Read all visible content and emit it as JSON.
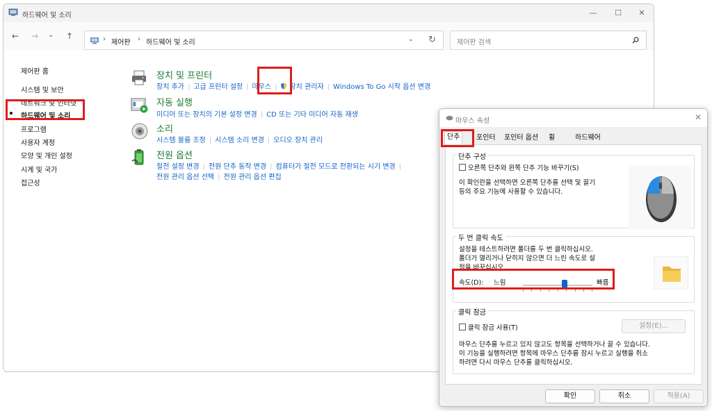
{
  "window": {
    "title": "하드웨어 및 소리",
    "controls": {
      "minimize": "—",
      "maximize": "☐",
      "close": "✕"
    }
  },
  "nav": {
    "back": "←",
    "forward": "→",
    "recent": "⌄",
    "up": "↑",
    "breadcrumb": [
      "제어판",
      "하드웨어 및 소리"
    ],
    "separator": "›",
    "dropdown": "⌄",
    "refresh": "↻",
    "search_placeholder": "제어판 검색"
  },
  "sidebar": {
    "home": "제어판 홈",
    "items": [
      {
        "label": "시스템 및 보안",
        "active": false
      },
      {
        "label": "네트워크 및 인터넷",
        "active": false
      },
      {
        "label": "하드웨어 및 소리",
        "active": true
      },
      {
        "label": "프로그램",
        "active": false
      },
      {
        "label": "사용자 계정",
        "active": false
      },
      {
        "label": "모양 및 개인 설정",
        "active": false
      },
      {
        "label": "시계 및 국가",
        "active": false
      },
      {
        "label": "접근성",
        "active": false
      }
    ]
  },
  "categories": [
    {
      "title": "장치 및 프린터",
      "icon": "printer-icon",
      "links": [
        "장치 추가",
        "고급 프린터 설정",
        "마우스",
        "장치 관리자",
        "Windows To Go 시작 옵션 변경"
      ]
    },
    {
      "title": "자동 실행",
      "icon": "autoplay-icon",
      "links": [
        "미디어 또는 장치의 기본 설정 변경",
        "CD 또는 기타 미디어 자동 재생"
      ]
    },
    {
      "title": "소리",
      "icon": "speaker-icon",
      "links": [
        "시스템 볼륨 조정",
        "시스템 소리 변경",
        "오디오 장치 관리"
      ]
    },
    {
      "title": "전원 옵션",
      "icon": "battery-icon",
      "links": [
        "절전 설정 변경",
        "전원 단추 동작 변경",
        "컴퓨터가 절전 모드로 전환되는 시기 변경"
      ],
      "links2": [
        "전원 관리 옵션 선택",
        "전원 관리 옵션 편집"
      ]
    }
  ],
  "dialog": {
    "title": "마우스 속성",
    "close": "✕",
    "tabs": [
      "단추",
      "포인터",
      "포인터 옵션",
      "휠",
      "하드웨어"
    ],
    "active_tab": "단추",
    "button_config": {
      "group_title": "단추 구성",
      "checkbox_label": "오른쪽 단추와 왼쪽 단추 기능 바꾸기(S)",
      "checked": false,
      "description": [
        "이 확인란을 선택하면 오른쪽 단추를 선택 및 끌기",
        "등의 주요 기능에 사용할 수 있습니다."
      ]
    },
    "double_click": {
      "group_title": "두 번 클릭 속도",
      "description": [
        "설정을 테스트하려면 폴더를 두 번 클릭하십시오.",
        "폴더가 열리거나 닫히지 않으면 더 느린 속도로 설",
        "정을 바꾸십시오."
      ],
      "speed_label": "속도(D):",
      "slow": "느림",
      "fast": "빠름",
      "speed_level": 0.6
    },
    "click_lock": {
      "group_title": "클릭 잠금",
      "checkbox_label": "클릭 잠금 사용(T)",
      "checked": false,
      "settings_button": "설정(E)...",
      "description": [
        "마우스 단추를 누르고 있지 않고도 항목을 선택하거나 끌 수 있습니다.",
        "이 기능을 실행하려면 항목에 마우스 단추를 잠시 누르고 실행을 취소",
        "하려면 다시 마우스 단추를 클릭하십시오."
      ]
    },
    "buttons": {
      "ok": "확인",
      "cancel": "취소",
      "apply": "적용(A)"
    }
  },
  "colors": {
    "link": "#1464c8",
    "category": "#1e7a32",
    "highlight": "#e01b1b",
    "slider": "#0a64d0"
  }
}
